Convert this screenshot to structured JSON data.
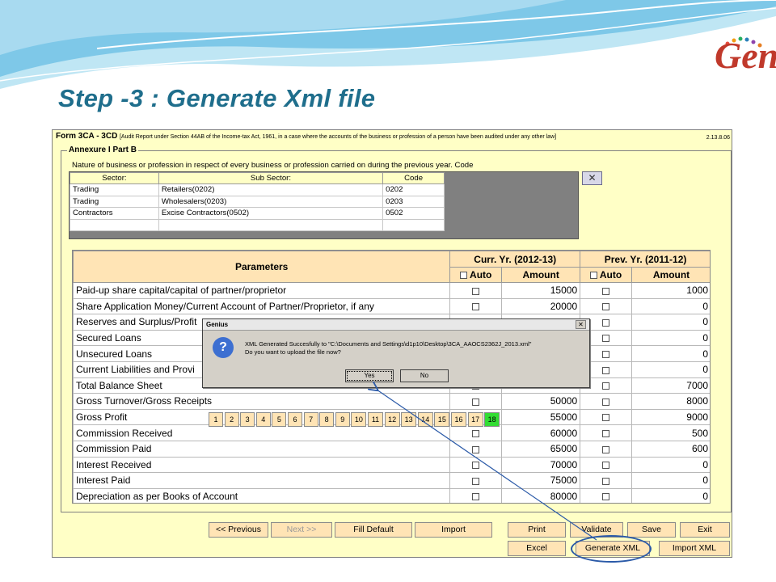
{
  "slide": {
    "title": "Step -3 : Generate Xml file",
    "logo_text": "Gen"
  },
  "form": {
    "title": "Form 3CA - 3CD",
    "subtitle": "[Audit Report under Section 44AB of the Income-tax Act, 1961, in a case where the accounts of the business or profession of a person have been audited under any other law]",
    "version": "2.13.8.06",
    "annexure_label": "Annexure I Part B",
    "nature_text": "Nature of business or profession in respect of every business or profession carried on during the previous year. Code",
    "close_symbol": "✕"
  },
  "sector_table": {
    "headers": [
      "Sector:",
      "Sub Sector:",
      "Code"
    ],
    "rows": [
      [
        "Trading",
        "Retailers(0202)",
        "0202"
      ],
      [
        "Trading",
        "Wholesalers(0203)",
        "0203"
      ],
      [
        "Contractors",
        "Excise Contractors(0502)",
        "0502"
      ],
      [
        "",
        "",
        ""
      ]
    ]
  },
  "params_table": {
    "header_parameters": "Parameters",
    "header_curr": "Curr. Yr. (2012-13)",
    "header_prev": "Prev. Yr. (2011-12)",
    "header_auto": "Auto",
    "header_amount": "Amount",
    "rows": [
      {
        "name": "Paid-up share capital/capital of partner/proprietor",
        "curr": "15000",
        "prev": "1000"
      },
      {
        "name": "Share Application Money/Current Account of Partner/Proprietor, if any",
        "curr": "20000",
        "prev": "0"
      },
      {
        "name": "Reserves and Surplus/Profit",
        "curr": "",
        "prev": "0"
      },
      {
        "name": "Secured Loans",
        "curr": "",
        "prev": "0"
      },
      {
        "name": "Unsecured Loans",
        "curr": "",
        "prev": "0"
      },
      {
        "name": "Current Liabilities and Provi",
        "curr": "",
        "prev": "0"
      },
      {
        "name": "Total Balance Sheet",
        "curr": "",
        "prev": "7000"
      },
      {
        "name": "Gross Turnover/Gross Receipts",
        "curr": "50000",
        "prev": "8000"
      },
      {
        "name": "Gross Profit",
        "curr": "55000",
        "prev": "9000"
      },
      {
        "name": "Commission Received",
        "curr": "60000",
        "prev": "500"
      },
      {
        "name": "Commission Paid",
        "curr": "65000",
        "prev": "600"
      },
      {
        "name": "Interest Received",
        "curr": "70000",
        "prev": "0"
      },
      {
        "name": "Interest Paid",
        "curr": "75000",
        "prev": "0"
      },
      {
        "name": "Depreciation as per Books of Account",
        "curr": "80000",
        "prev": "0"
      }
    ]
  },
  "dialog": {
    "title": "Genius",
    "line1": "XML Generated Succesfully to \"C:\\Documents and Settings\\d1p10\\Desktop\\3CA_AAOCS2362J_2013.xml\"",
    "line2": "Do you want to upload the file now?",
    "yes": "Yes",
    "no": "No",
    "icon": "?",
    "close": "✕"
  },
  "buttons": {
    "previous": "<< Previous",
    "next": "Next >>",
    "fill_default": "Fill Default",
    "import": "Import",
    "print": "Print",
    "validate": "Validate",
    "save": "Save",
    "exit": "Exit",
    "excel": "Excel",
    "generate_xml": "Generate XML",
    "import_xml": "Import XML"
  },
  "pages": [
    "1",
    "2",
    "3",
    "4",
    "5",
    "6",
    "7",
    "8",
    "9",
    "10",
    "11",
    "12",
    "13",
    "14",
    "15",
    "16",
    "17",
    "18"
  ],
  "active_page": "18"
}
